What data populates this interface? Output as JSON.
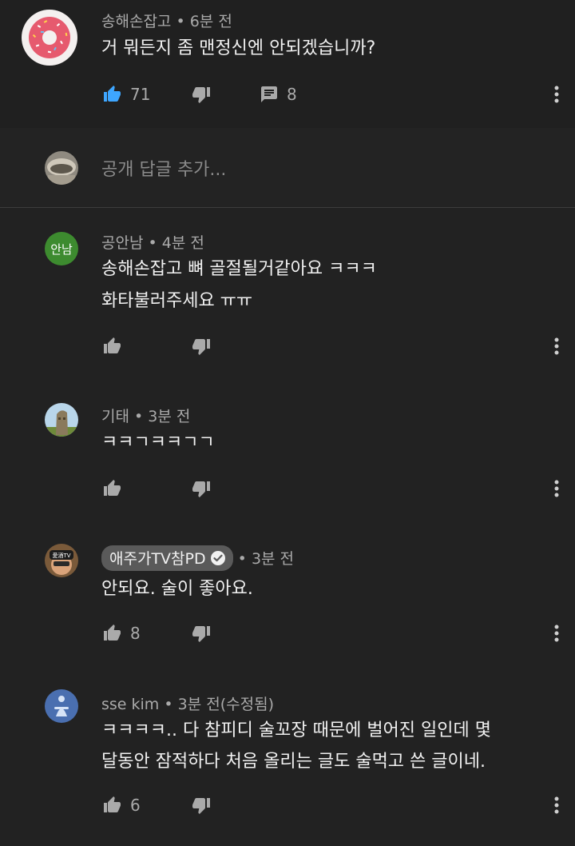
{
  "top_comment": {
    "author": "송해손잡고",
    "time": "6분 전",
    "text": "거 뭐든지 좀 맨정신엔 안되겠습니까?",
    "likes": "71",
    "replies": "8",
    "avatar_icon": "donut-avatar"
  },
  "reply_input": {
    "placeholder": "공개 답글 추가...",
    "avatar_icon": "user-avatar"
  },
  "replies": [
    {
      "author": "공안남",
      "time": "4분 전",
      "lines": [
        "송해손잡고 뼈 골절될거같아요 ㅋㅋㅋ",
        "화타불러주세요 ㅠㅠ"
      ],
      "avatar_text": "안남",
      "avatar_color": "#3d8b2f",
      "likes": ""
    },
    {
      "author": "기태",
      "time": "3분 전",
      "lines": [
        "ㅋㅋㄱㅋㅋㄱㄱ"
      ],
      "avatar_icon": "moai-avatar",
      "likes": ""
    },
    {
      "author": "애주가TV참PD",
      "time": "3분 전",
      "lines": [
        "안되요. 술이 좋아요."
      ],
      "avatar_icon": "creator-avatar",
      "likes": "8",
      "verified": true
    },
    {
      "author": "sse kim",
      "time": "3분 전(수정됨)",
      "lines": [
        "ㅋㅋㅋㅋ.. 다 참피디 술꼬장 때문에 벌어진 일인데 몇",
        "달동안 잠적하다 처음 올리는 글도 술먹고 쓴 글이네."
      ],
      "avatar_icon": "figure-avatar",
      "likes": "6"
    }
  ],
  "separator": "•",
  "colors": {
    "background": "#222222",
    "like_active": "#3ea6ff",
    "secondary_text": "#aaaaaa"
  }
}
